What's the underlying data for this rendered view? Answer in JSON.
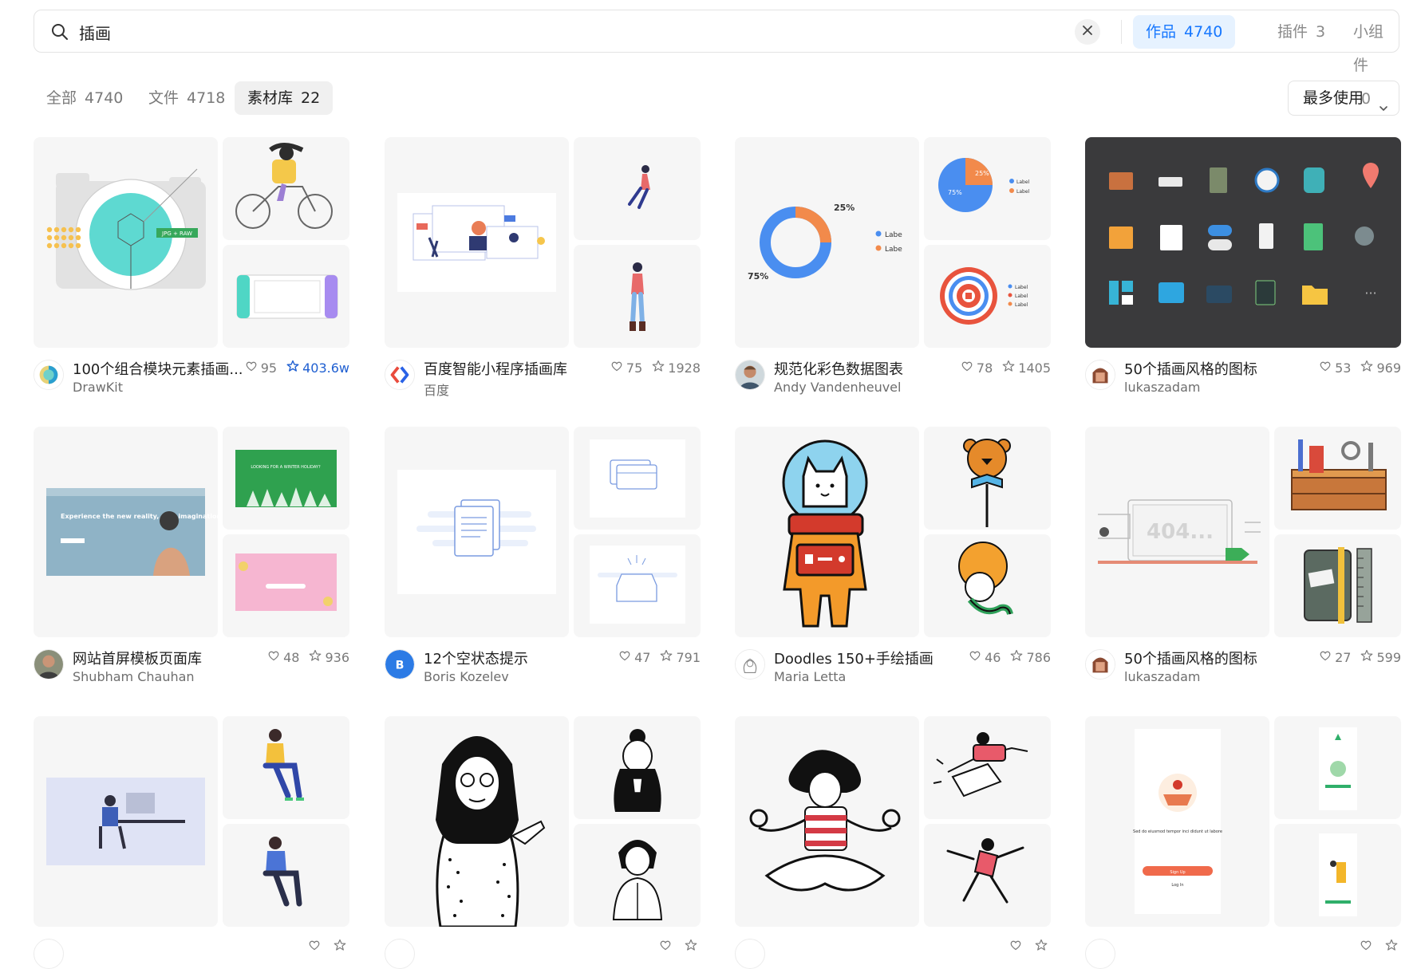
{
  "search": {
    "value": "插画",
    "scope_tabs": [
      {
        "label": "作品",
        "count": "4740",
        "active": true
      },
      {
        "label": "插件",
        "count": "3",
        "active": false
      },
      {
        "label": "小组件",
        "count": "0",
        "active": false
      }
    ]
  },
  "filters": {
    "tabs": [
      {
        "label": "全部",
        "count": "4740",
        "active": false
      },
      {
        "label": "文件",
        "count": "4718",
        "active": false
      },
      {
        "label": "素材库",
        "count": "22",
        "active": true
      }
    ],
    "sort_label": "最多使用"
  },
  "colors": {
    "accent": "#1677ff",
    "accent_bg": "#e6f2ff"
  },
  "cards": [
    {
      "title": "100个组合模块元素插画...",
      "author": "DrawKit",
      "likes": "95",
      "stars": "403.6w",
      "starred": true
    },
    {
      "title": "百度智能小程序插画库",
      "author": "百度",
      "likes": "75",
      "stars": "1928",
      "starred": false
    },
    {
      "title": "规范化彩色数据图表",
      "author": "Andy Vandenheuvel",
      "likes": "78",
      "stars": "1405",
      "starred": false
    },
    {
      "title": "50个插画风格的图标",
      "author": "lukaszadam",
      "likes": "53",
      "stars": "969",
      "starred": false
    },
    {
      "title": "网站首屏模板页面库",
      "author": "Shubham Chauhan",
      "likes": "48",
      "stars": "936",
      "starred": false
    },
    {
      "title": "12个空状态提示",
      "author": "Boris Kozelev",
      "likes": "47",
      "stars": "791",
      "starred": false
    },
    {
      "title": "Doodles 150+手绘插画",
      "author": "Maria Letta",
      "likes": "46",
      "stars": "786",
      "starred": false
    },
    {
      "title": "50个插画风格的图标",
      "author": "lukaszadam",
      "likes": "27",
      "stars": "599",
      "starred": false
    },
    {
      "title": "",
      "author": "",
      "likes": "",
      "stars": "",
      "starred": false
    },
    {
      "title": "",
      "author": "",
      "likes": "",
      "stars": "",
      "starred": false
    },
    {
      "title": "",
      "author": "",
      "likes": "",
      "stars": "",
      "starred": false
    },
    {
      "title": "",
      "author": "",
      "likes": "",
      "stars": "",
      "starred": false
    }
  ],
  "icons": [
    "search-icon",
    "clear-icon",
    "chevron-down-icon",
    "heart-icon",
    "star-icon"
  ],
  "thumb_text": {
    "jpg_raw": "JPG + RAW",
    "pct_25": "25%",
    "pct_75": "75%",
    "label_a": "Labe",
    "label_b": "Label",
    "banner_title": "Experience the new reality, new imagination",
    "holiday_title": "LOOKING FOR A WINTER HOLIDAY?",
    "not_found": "404...",
    "icons_more": "···",
    "avatar_b": "B",
    "app_heading": "Sed do eiusmod tempor inci didunt ut labore",
    "app_button": "Sign Up",
    "app_login": "Log In"
  }
}
